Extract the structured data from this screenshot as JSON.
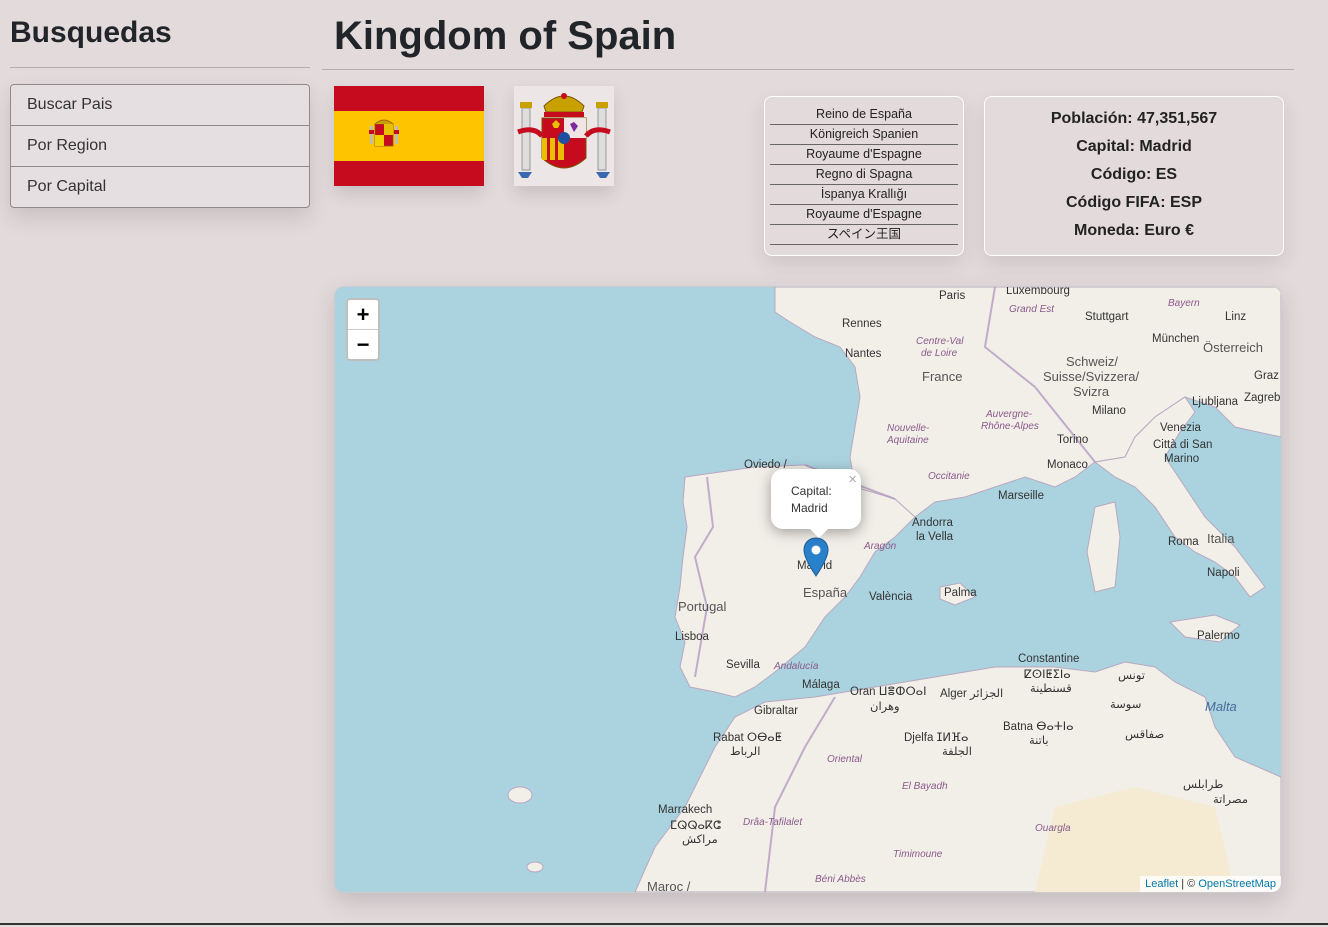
{
  "sidebar": {
    "title": "Busquedas",
    "items": [
      {
        "label": "Buscar Pais"
      },
      {
        "label": "Por Region"
      },
      {
        "label": "Por Capital"
      }
    ]
  },
  "country": {
    "title": "Kingdom of Spain",
    "translations": [
      "Reino de España",
      "Königreich Spanien",
      "Royaume d'Espagne",
      "Regno di Spagna",
      "İspanya Krallığı",
      "Royaume d'Espagne",
      "スペイン王国"
    ],
    "info": {
      "population": "Población: 47,351,567",
      "capital": "Capital: Madrid",
      "code": "Código: ES",
      "fifa": "Código FIFA: ESP",
      "currency": "Moneda: Euro €"
    }
  },
  "map": {
    "zoom_in": "+",
    "zoom_out": "−",
    "popup_line1": "Capital:",
    "popup_line2": "Madrid",
    "popup_close": "×",
    "attribution_leaflet": "Leaflet",
    "attribution_sep": " | © ",
    "attribution_osm": "OpenStreetMap",
    "labels": {
      "paris": "Paris",
      "luxembourg": "Luxembourg",
      "rennes": "Rennes",
      "nantes": "Nantes",
      "france": "France",
      "stuttgart": "Stuttgart",
      "munchen": "München",
      "osterreich": "Österreich",
      "schweiz1": "Schweiz/",
      "schweiz2": "Suisse/Svizzera/",
      "schweiz3": "Svizra",
      "milano": "Milano",
      "torino": "Torino",
      "monaco": "Monaco",
      "marseille": "Marseille",
      "venezia": "Venezia",
      "sanmarino1": "Città di San",
      "sanmarino2": "Marino",
      "ljubljana": "Ljubljana",
      "zagreb": "Zagreb",
      "graz": "Graz",
      "linz": "Linz",
      "roma": "Roma",
      "italia": "Italia",
      "napoli": "Napoli",
      "palermo": "Palermo",
      "malta": "Malta",
      "oviedo": "Oviedo /",
      "andorra1": "Andorra",
      "andorra2": "la Vella",
      "madrid": "Madrid",
      "espana": "España",
      "valencia": "València",
      "palma": "Palma",
      "portugal": "Portugal",
      "lisboa": "Lisboa",
      "sevilla": "Sevilla",
      "malaga": "Málaga",
      "gibraltar": "Gibraltar",
      "rabat": "Rabat ⵔⴱⴰⵟ",
      "rabat_ar": "الرباط",
      "oran": "Oran ⵡⴻⵀⵔⴰⵏ",
      "oran_ar": "وهران",
      "alger": "Alger الجزائر",
      "constantine": "Constantine",
      "constantine_tz": "ⵇⵙⵏⵟⵉⵏⴰ",
      "constantine_ar": "قسنطينة",
      "batna": "Batna ⴱⴰⵜⵏⴰ",
      "batna_ar": "باتنة",
      "djelfa": "Djelfa ⵊⵍⴼⴰ",
      "djelfa_ar": "الجلفة",
      "marrakech": "Marrakech",
      "marrakech_tz": "ⵎⵕⵕⴰⴽⵛ",
      "marrakech_ar": "مراكش",
      "maroc": "Maroc /",
      "tunis": "تونس",
      "sousse": "سوسة",
      "sfax": "صفاقس",
      "tripoli": "طرابلس",
      "misrata": "مصراتة",
      "bayern": "Bayern",
      "grandest": "Grand Est",
      "centreval1": "Centre-Val",
      "centreval2": "de Loire",
      "nouvelle1": "Nouvelle-",
      "nouvelle2": "Aquitaine",
      "auvergne1": "Auvergne-",
      "auvergne2": "Rhône-Alpes",
      "occitanie": "Occitanie",
      "aragon": "Aragón",
      "andalucia": "Andalucía",
      "oriental": "Oriental",
      "elbayadh": "El Bayadh",
      "ouargla": "Ouargla",
      "timimoune": "Timimoune",
      "beniabbes": "Béni Abbès",
      "draa": "Drâa-Tafilalet"
    }
  },
  "colors": {
    "page_bg": "#e3dadc",
    "sea": "#aad3df",
    "land": "#f2efe9",
    "flag_red": "#c60b1e",
    "flag_yellow": "#ffc400",
    "marker": "#2a81cb"
  }
}
